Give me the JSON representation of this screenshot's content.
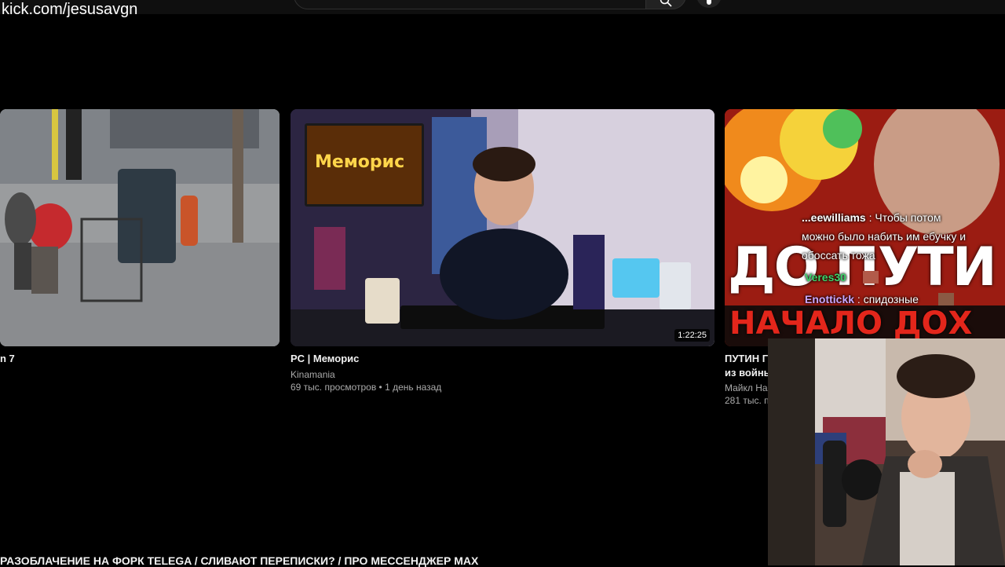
{
  "overlay": {
    "url_text": "kick.com/jesusavgn"
  },
  "header": {
    "search_icon": "search-icon",
    "mic_icon": "mic-icon"
  },
  "videos": [
    {
      "title": "n 7"
    },
    {
      "title": "PC | Меморис",
      "channel": "Kinamania",
      "stats": "69 тыс. просмотров • 1 день назад",
      "duration": "1:22:25",
      "thumb_sign": "Меморис"
    },
    {
      "title_line1": "ПУТИН Г",
      "title_line2": "из войны",
      "channel": "Майкл На",
      "stats": "281 тыс. п",
      "thumb_text_top": "ДО ПУТИ",
      "thumb_text_bottom": "НАЧАЛО ДОХ"
    }
  ],
  "chat": [
    {
      "user": "...eewilliams",
      "message": "Чтобы потом",
      "user_color": "#ffffff"
    },
    {
      "user": "",
      "message": "можно было набить им ебучку и",
      "user_color": "#ffffff"
    },
    {
      "user": "",
      "message": "обоссать тожа",
      "user_color": "#ffffff"
    },
    {
      "user": "Veres30",
      "message": "",
      "user_color": "#3cd46a"
    },
    {
      "user": "Enottickk",
      "message": "спидозные",
      "user_color": "#c9a7ff"
    }
  ],
  "bottom": {
    "title": "РАЗОБЛАЧЕНИЕ НА ФОРК TELEGA / СЛИВАЮТ ПЕРЕПИСКИ? / ПРО МЕССЕНДЖЕР MAX"
  },
  "colors": {
    "background": "#000000",
    "meta_text": "#aaaaaa",
    "accent_red": "#d32f2f"
  }
}
